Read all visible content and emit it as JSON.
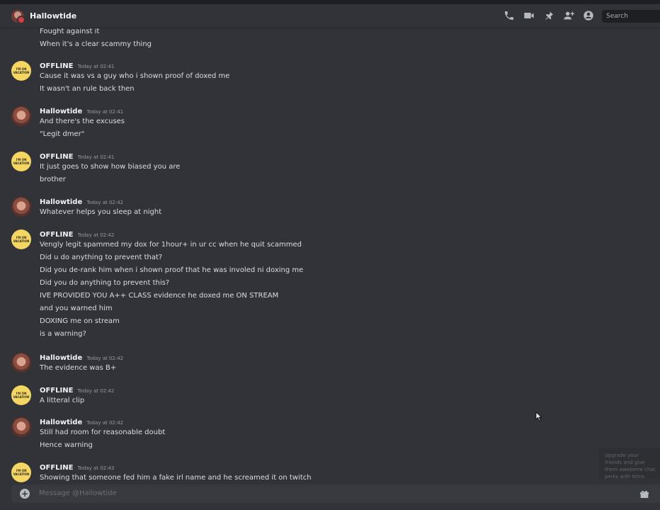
{
  "header": {
    "title": "Hallowtide",
    "search_placeholder": "Search",
    "icons": [
      "call-icon",
      "video-icon",
      "pin-icon",
      "add-friend-icon",
      "profile-icon"
    ]
  },
  "avatars": {
    "offline_text": "I'M ON VACATION"
  },
  "messages": [
    {
      "author": "",
      "time": "",
      "lines": [
        "Fought against it",
        "When it's a clear scammy thing"
      ]
    },
    {
      "author": "OFFLINE",
      "time": "Today at 02:41",
      "lines": [
        "Cause it was vs a guy who i shown proof of doxed me",
        "It wasn't an rule back then"
      ]
    },
    {
      "author": "Hallowtide",
      "time": "Today at 02:41",
      "lines": [
        "And there's the excuses",
        "\"Legit dmer\""
      ]
    },
    {
      "author": "OFFLINE",
      "time": "Today at 02:41",
      "lines": [
        "It just goes to show how biased you are",
        "brother"
      ]
    },
    {
      "author": "Hallowtide",
      "time": "Today at 02:42",
      "lines": [
        "Whatever helps you sleep at night"
      ]
    },
    {
      "author": "OFFLINE",
      "time": "Today at 02:42",
      "lines": [
        "Vengly legit spammed my dox for 1hour+ in ur cc when he quit scammed",
        "Did u do anything to prevent that?",
        "Did you de-rank him when i shown proof that he was involed ni doxing me",
        "Did you do anything to prevent this?",
        "IVE PROVIDED YOU A++ CLASS evidence he doxed me ON STREAM",
        "and you warned him",
        "DOXING me on stream",
        "is a warning?"
      ]
    },
    {
      "author": "Hallowtide",
      "time": "Today at 02:42",
      "lines": [
        "The evidence was B+"
      ]
    },
    {
      "author": "OFFLINE",
      "time": "Today at 02:42",
      "lines": [
        "A litteral clip"
      ]
    },
    {
      "author": "Hallowtide",
      "time": "Today at 02:42",
      "lines": [
        "Still had room for reasonable doubt",
        "Hence warning"
      ]
    },
    {
      "author": "OFFLINE",
      "time": "Today at 02:43",
      "lines": [
        "Showing that someone fed him a fake irl name and he screamed it on twitch"
      ]
    }
  ],
  "composer": {
    "placeholder": "Message @Hallowtide"
  },
  "toast": {
    "text": "Upgrade your friends and give them awesome chat perks with Nitro."
  },
  "colors": {
    "background": "#313338",
    "status_red": "#d83c3e",
    "offline_avatar": "#f4d661"
  }
}
